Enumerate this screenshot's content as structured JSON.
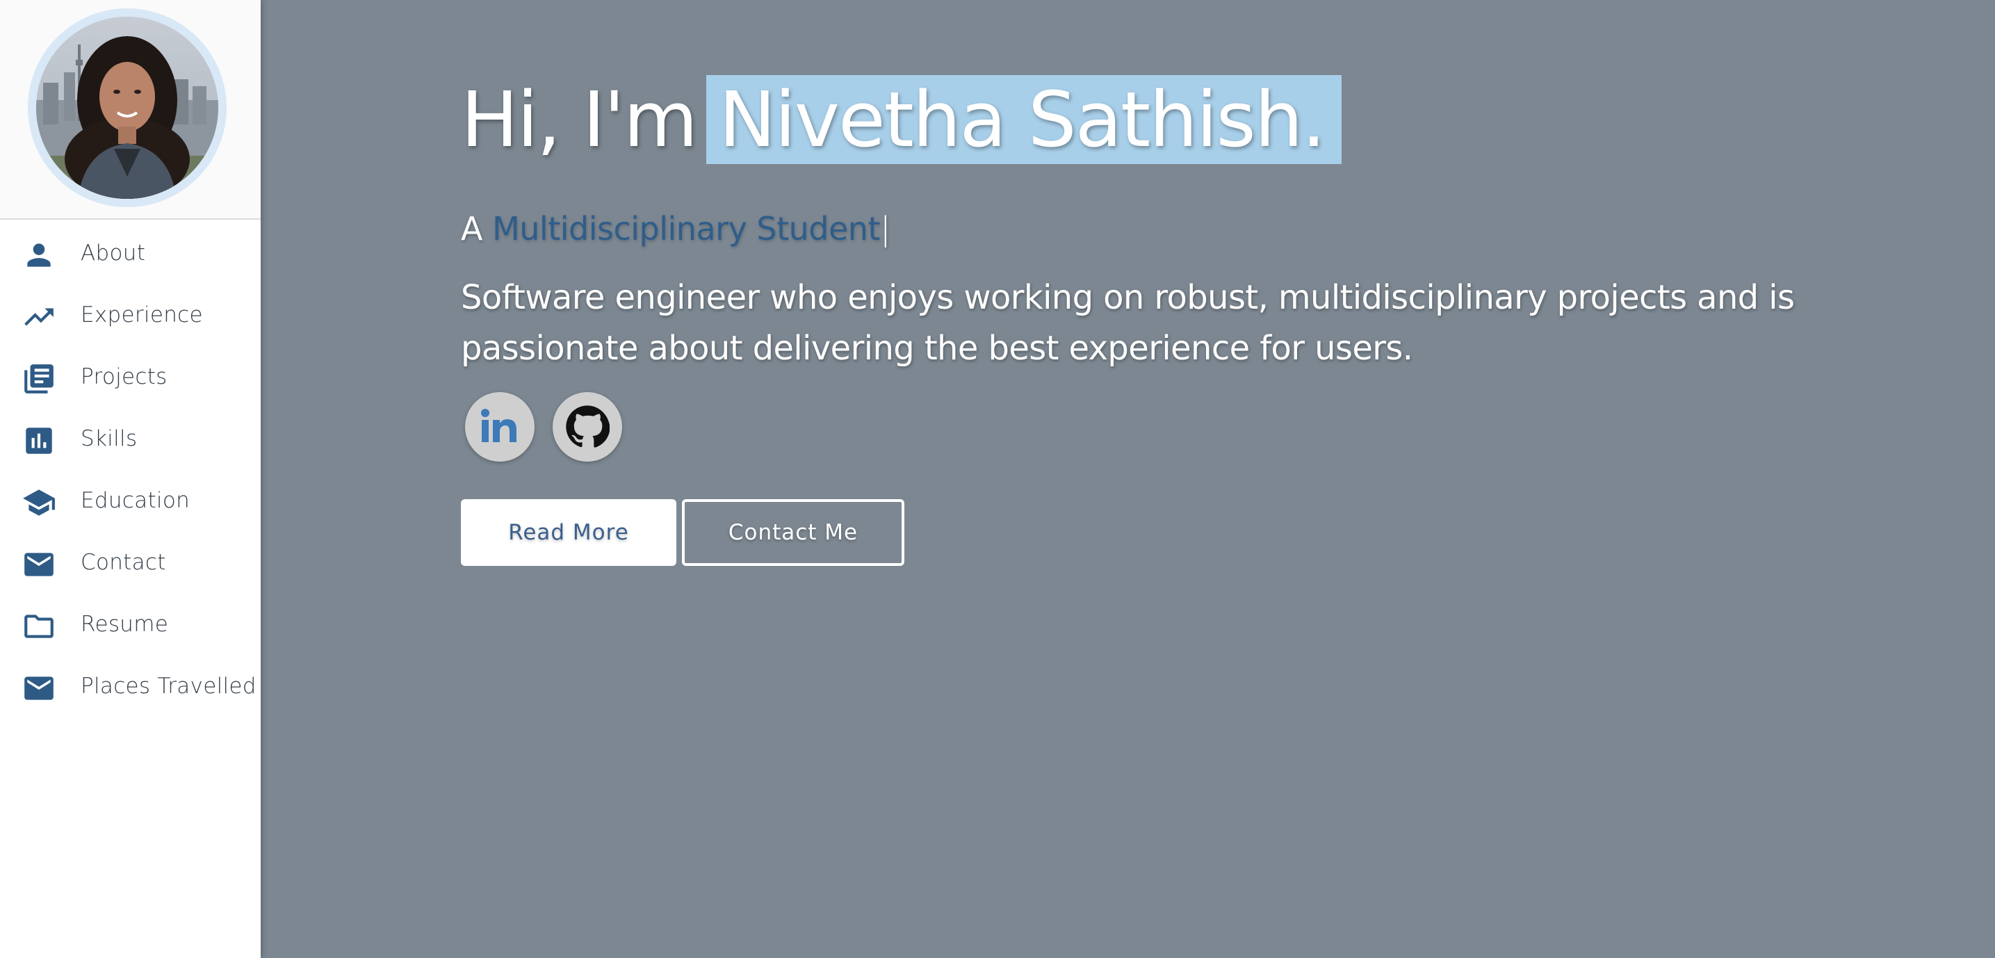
{
  "profile": {
    "avatar_alt": "Profile photo"
  },
  "nav": {
    "items": [
      {
        "label": "About",
        "icon": "person-icon"
      },
      {
        "label": "Experience",
        "icon": "trending-up-icon"
      },
      {
        "label": "Projects",
        "icon": "library-books-icon"
      },
      {
        "label": "Skills",
        "icon": "bar-chart-icon"
      },
      {
        "label": "Education",
        "icon": "school-icon"
      },
      {
        "label": "Contact",
        "icon": "mail-icon"
      },
      {
        "label": "Resume",
        "icon": "folder-icon"
      },
      {
        "label": "Places Travelled",
        "icon": "mail-icon"
      }
    ]
  },
  "hero": {
    "greeting": "Hi, I'm",
    "name": "Nivetha Sathish.",
    "subtitle_prefix": "A",
    "role": "Multidisciplinary Student",
    "caret": "|",
    "tagline": "Software engineer who enjoys working on robust, multidisciplinary projects and is passionate about delivering the best experience for users.",
    "social": [
      {
        "name": "linkedin",
        "icon": "linkedin-icon"
      },
      {
        "name": "github",
        "icon": "github-icon"
      }
    ],
    "read_more_label": "Read More",
    "contact_label": "Contact Me"
  },
  "colors": {
    "background": "#7c8791",
    "accent": "#2f5d8a",
    "name_highlight": "#a8cfe9",
    "icon": "#2e5b86"
  }
}
